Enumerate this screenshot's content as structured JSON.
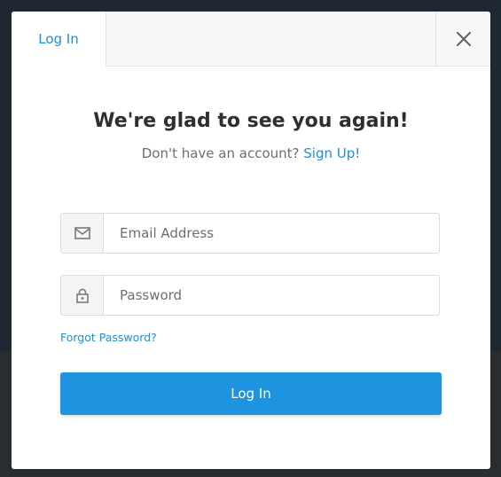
{
  "modal": {
    "tab_label": "Log In",
    "title": "We're glad to see you again!",
    "subtitle_text": "Don't have an account?",
    "signup_link": "Sign Up!",
    "email": {
      "placeholder": "Email Address",
      "value": "",
      "icon": "mail-icon"
    },
    "password": {
      "placeholder": "Password",
      "value": "",
      "icon": "lock-icon"
    },
    "forgot_link": "Forgot Password?",
    "submit_label": "Log In",
    "close_icon": "close-icon"
  },
  "colors": {
    "accent": "#1e93e0",
    "link": "#1e8fd6",
    "title": "#2d2f31",
    "backdrop": "#1d2832"
  }
}
